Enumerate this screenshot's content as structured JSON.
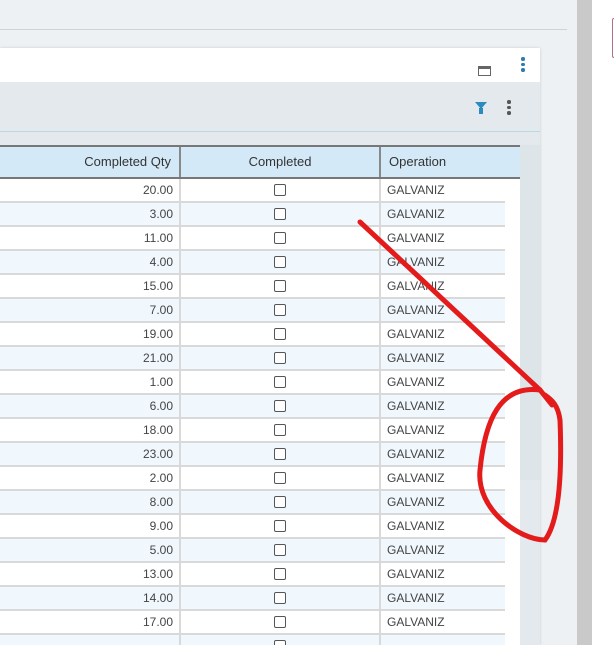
{
  "grid": {
    "columns": [
      "Completed Qty",
      "Completed",
      "Operation"
    ],
    "rows": [
      {
        "qty": "20.00",
        "completed": false,
        "operation": "GALVANIZ"
      },
      {
        "qty": "3.00",
        "completed": false,
        "operation": "GALVANIZ"
      },
      {
        "qty": "11.00",
        "completed": false,
        "operation": "GALVANIZ"
      },
      {
        "qty": "4.00",
        "completed": false,
        "operation": "GALVANIZ"
      },
      {
        "qty": "15.00",
        "completed": false,
        "operation": "GALVANIZ"
      },
      {
        "qty": "7.00",
        "completed": false,
        "operation": "GALVANIZ"
      },
      {
        "qty": "19.00",
        "completed": false,
        "operation": "GALVANIZ"
      },
      {
        "qty": "21.00",
        "completed": false,
        "operation": "GALVANIZ"
      },
      {
        "qty": "1.00",
        "completed": false,
        "operation": "GALVANIZ"
      },
      {
        "qty": "6.00",
        "completed": false,
        "operation": "GALVANIZ"
      },
      {
        "qty": "18.00",
        "completed": false,
        "operation": "GALVANIZ"
      },
      {
        "qty": "23.00",
        "completed": false,
        "operation": "GALVANIZ"
      },
      {
        "qty": "2.00",
        "completed": false,
        "operation": "GALVANIZ"
      },
      {
        "qty": "8.00",
        "completed": false,
        "operation": "GALVANIZ"
      },
      {
        "qty": "9.00",
        "completed": false,
        "operation": "GALVANIZ"
      },
      {
        "qty": "5.00",
        "completed": false,
        "operation": "GALVANIZ"
      },
      {
        "qty": "13.00",
        "completed": false,
        "operation": "GALVANIZ"
      },
      {
        "qty": "14.00",
        "completed": false,
        "operation": "GALVANIZ"
      },
      {
        "qty": "17.00",
        "completed": false,
        "operation": "GALVANIZ"
      }
    ]
  },
  "colors": {
    "accent": "#2a8bbf",
    "header_bg": "#d4e9f7",
    "annotation": "#e31b1b"
  }
}
